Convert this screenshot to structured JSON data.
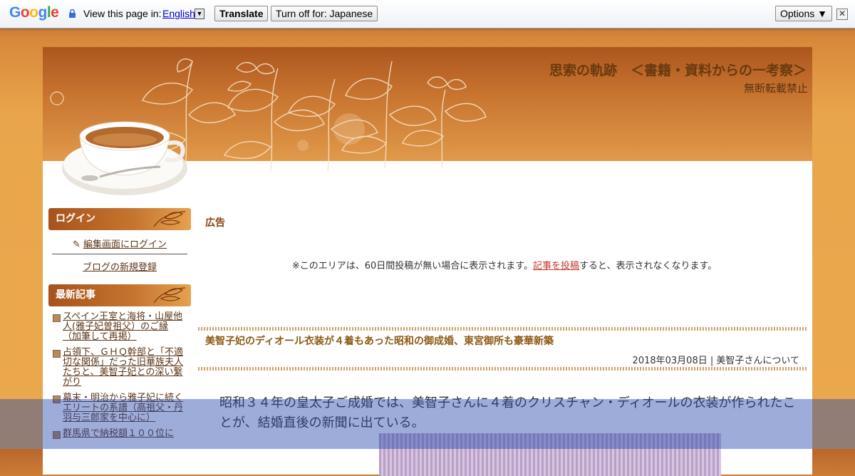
{
  "translate_bar": {
    "logo": "Google",
    "prompt": "View this page in:",
    "language": "English",
    "translate_button": "Translate",
    "turn_off_button": "Turn off for: Japanese",
    "options_button": "Options ▼",
    "close_glyph": "✕"
  },
  "header": {
    "title": "思索の軌跡　＜書籍・資料からの一考察＞",
    "subtitle": "無断転載禁止"
  },
  "sidebar": {
    "login_heading": "ログイン",
    "login_link": "編集画面にログイン",
    "register_link": "ブログの新規登録",
    "recent_heading": "最新記事",
    "recent_items": [
      "スペイン王室と海将・山屋他人(雅子妃曽祖父）のご縁（加筆して再掲）",
      "占領下、ＧＨＱ幹部と「不適切な関係」だった旧華族夫人たちと、美智子妃との深い繋がり",
      "幕末・明治から雅子妃に続くエリートの系譜（高祖父・丹羽与三郎家を中心に）",
      "群馬県で納税額１００位に"
    ]
  },
  "main": {
    "ad_heading": "広告",
    "ad_note_before": "※このエリアは、60日間投稿が無い場合に表示されます。",
    "ad_note_link": "記事を投稿",
    "ad_note_after": "すると、表示されなくなります。",
    "post_title": "美智子妃のディオール衣装が４着もあった昭和の御成婚、東宮御所も豪華新築",
    "post_date": "2018年03月08日",
    "post_category": "美智子さんについて",
    "post_body": "昭和３４年の皇太子ご成婚では、美智子さんに４着のクリスチャン・ディオールの衣装が作られたことが、結婚直後の新聞に出ている。"
  },
  "colors": {
    "header_brown": "#ac561f",
    "accent_link": "#c0392b",
    "overlay_blue": "#2846aa"
  }
}
